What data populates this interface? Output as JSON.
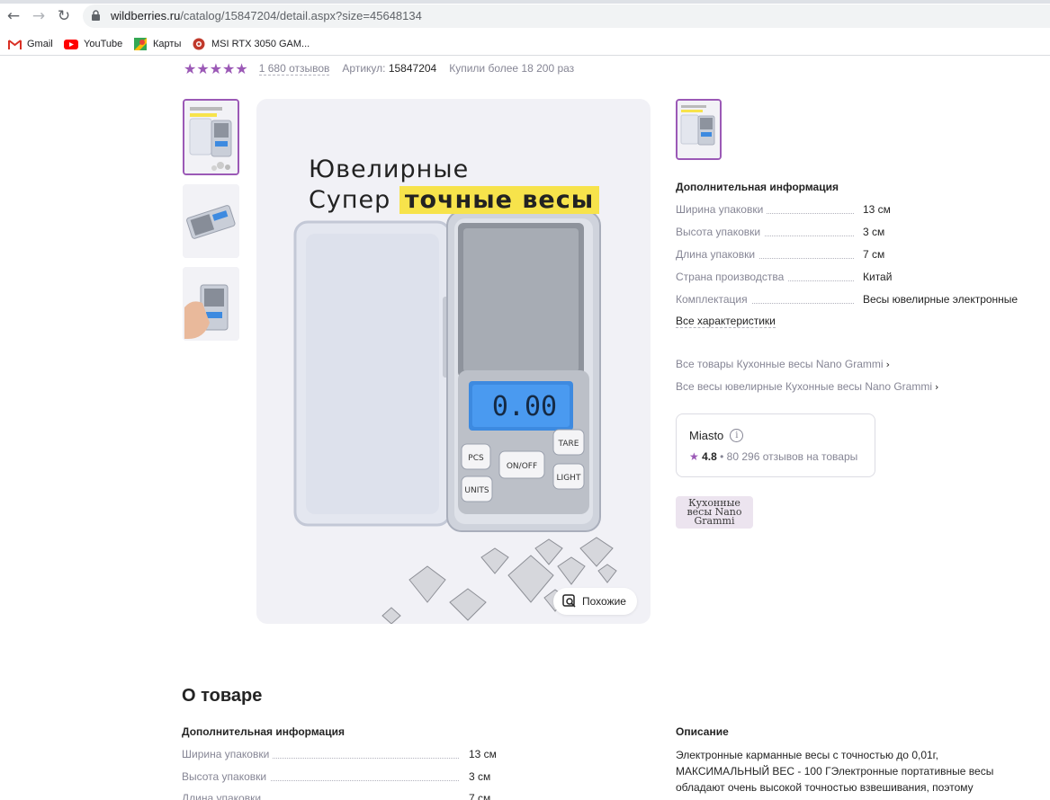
{
  "browser": {
    "url_host": "wildberries.ru",
    "url_path": "/catalog/15847204/detail.aspx?size=45648134",
    "bookmarks": [
      {
        "label": "Gmail",
        "icon": "gmail-icon"
      },
      {
        "label": "YouTube",
        "icon": "youtube-icon"
      },
      {
        "label": "Карты",
        "icon": "maps-icon"
      },
      {
        "label": "MSI RTX 3050 GAM...",
        "icon": "msi-icon"
      }
    ]
  },
  "product": {
    "stars": "★★★★★",
    "rating_value": 5,
    "reviews": "1 680 отзывов",
    "article_label": "Артикул:",
    "article_value": "15847204",
    "bought": "Купили более 18 200 раз",
    "image_heading_line1": "Ювелирные",
    "image_heading_line2_plain": "Супер",
    "image_heading_line2_highlight": "точные весы",
    "scale_display": "0.00",
    "scale_buttons": {
      "pcs": "PCS",
      "tare": "TARE",
      "onoff": "ON/OFF",
      "units": "UNITS",
      "light": "LIGHT"
    },
    "similar_label": "Похожие"
  },
  "details": {
    "title": "Дополнительная информация",
    "rows": [
      {
        "k": "Ширина упаковки",
        "v": "13 см"
      },
      {
        "k": "Высота упаковки",
        "v": "3 см"
      },
      {
        "k": "Длина упаковки",
        "v": "7 см"
      },
      {
        "k": "Страна производства",
        "v": "Китай"
      },
      {
        "k": "Комплектация",
        "v": "Весы ювелирные электронные"
      }
    ],
    "all_link": "Все характеристики"
  },
  "links": {
    "all_goods": "Все товары Кухонные весы Nano Grammi",
    "all_scales": "Все весы ювелирные Кухонные весы Nano Grammi"
  },
  "seller": {
    "name": "Miasto",
    "star": "★",
    "rating": "4.8",
    "reviews": "• 80 296 отзывов на товары"
  },
  "brand_logo_text": "Кухонные весы Nano Grammi",
  "about": {
    "title": "О товаре",
    "info_title": "Дополнительная информация",
    "rows": [
      {
        "k": "Ширина упаковки",
        "v": "13 см"
      },
      {
        "k": "Высота упаковки",
        "v": "3 см"
      },
      {
        "k": "Длина упаковки",
        "v": "7 см"
      }
    ],
    "desc_title": "Описание",
    "desc_text": "Электронные карманные весы с точностью до 0,01г, МАКСИМАЛЬНЫЙ ВЕС - 100 ГЭлектронные портативные весы обладают очень высокой точностью взвешивания, поэтому"
  },
  "colors": {
    "accent": "#9b59b6",
    "highlight": "#f7e34b",
    "muted": "#868695"
  }
}
